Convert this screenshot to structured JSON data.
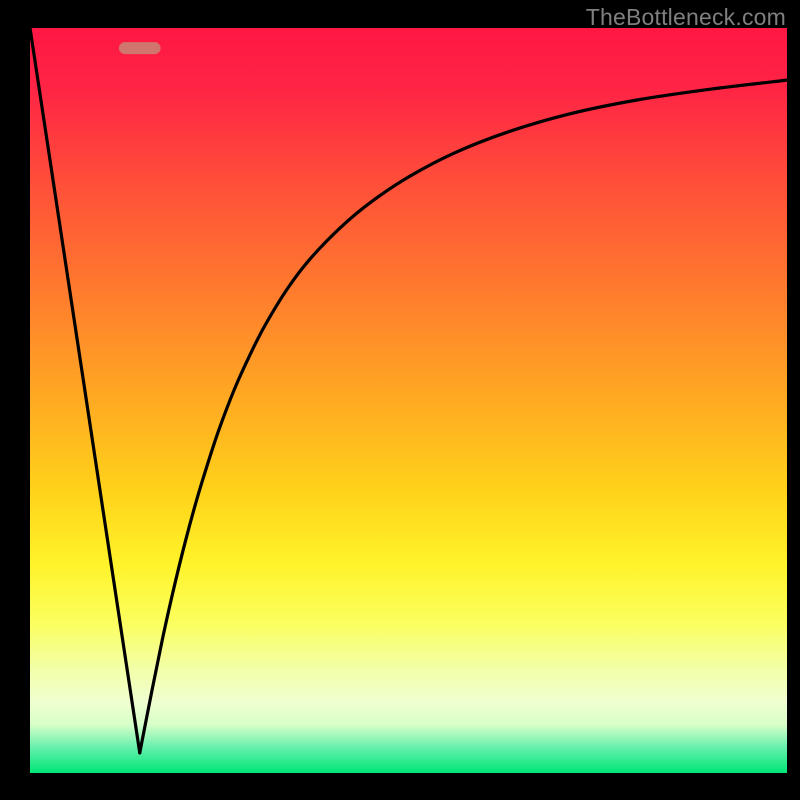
{
  "watermark": "TheBottleneck.com",
  "chart_data": {
    "type": "line",
    "title": "",
    "xlabel": "",
    "ylabel": "",
    "xlim": [
      0,
      100
    ],
    "ylim": [
      0,
      100
    ],
    "grid": false,
    "legend": false,
    "background_gradient_stops": [
      {
        "offset": 0.0,
        "color": "#ff1744"
      },
      {
        "offset": 0.08,
        "color": "#ff2445"
      },
      {
        "offset": 0.2,
        "color": "#ff4c3a"
      },
      {
        "offset": 0.35,
        "color": "#ff7a2e"
      },
      {
        "offset": 0.5,
        "color": "#ffaa22"
      },
      {
        "offset": 0.62,
        "color": "#ffd21a"
      },
      {
        "offset": 0.72,
        "color": "#fff32a"
      },
      {
        "offset": 0.8,
        "color": "#fbff60"
      },
      {
        "offset": 0.86,
        "color": "#f3ffa8"
      },
      {
        "offset": 0.905,
        "color": "#efffd0"
      },
      {
        "offset": 0.935,
        "color": "#d8ffc8"
      },
      {
        "offset": 0.965,
        "color": "#69f0ae"
      },
      {
        "offset": 1.0,
        "color": "#00e676"
      }
    ],
    "marker": {
      "shape": "rounded_rect",
      "cx": 14.5,
      "cy": 97.3,
      "width": 5.5,
      "height": 1.6,
      "rx": 0.8,
      "fill": "#d1756f"
    },
    "series": [
      {
        "name": "left_branch",
        "x": [
          0,
          14.5
        ],
        "y": [
          100,
          2.7
        ]
      },
      {
        "name": "right_branch",
        "x": [
          14.5,
          16,
          17.5,
          19,
          20.5,
          22,
          23.5,
          25,
          27,
          29,
          31,
          34,
          37,
          41,
          45,
          50,
          56,
          63,
          71,
          80,
          90,
          100
        ],
        "y": [
          2.7,
          10.5,
          18,
          24.8,
          31,
          36.6,
          41.6,
          46.2,
          51.5,
          56,
          60,
          65,
          69,
          73.2,
          76.6,
          80,
          83.2,
          86,
          88.4,
          90.3,
          91.8,
          93
        ]
      }
    ]
  }
}
